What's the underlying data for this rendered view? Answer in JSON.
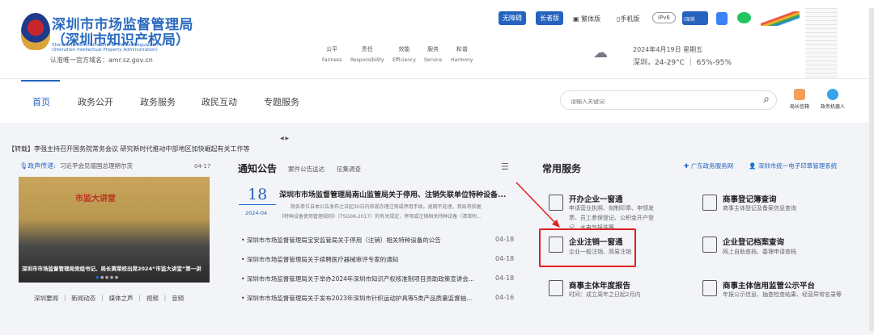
{
  "header": {
    "title_line1": "深圳市市场监督管理局",
    "title_line2": "（深圳市知识产权局）",
    "title_en1": "Shenzhen Administration For Market Regulation",
    "title_en2": "(Shenzhen Intellectual Property Administration)",
    "domain": "认准唯一官方域名：amr.sz.gov.cn",
    "values": [
      {
        "cn": "公平",
        "en": "Fairness"
      },
      {
        "cn": "责任",
        "en": "Responsibility"
      },
      {
        "cn": "效能",
        "en": "Efficiency"
      },
      {
        "cn": "服务",
        "en": "Service"
      },
      {
        "cn": "和谐",
        "en": "Harmony"
      }
    ],
    "toolbar": {
      "accessible": "无障碍",
      "elderly": "长者版",
      "traditional": "繁体版",
      "mobile": "手机版",
      "ipv6": "IPv6",
      "app": "i深圳"
    },
    "weather": {
      "date": "2024年4月19日 星期五",
      "line": "深圳，24-29°C  ｜ 65%-95%"
    },
    "accent": "#2563bf"
  },
  "nav": {
    "items": [
      "首页",
      "政务公开",
      "政务服务",
      "政民互动",
      "专题服务"
    ],
    "active": 0,
    "search_placeholder": "请输入关键词",
    "mailbox": "局长信箱",
    "robot": "政务机器人"
  },
  "headline": "【转载】李强主持召开国务院常务会议 研究新时代推动中部地区加快崛起有关工作等",
  "left": {
    "voice_label": "政声传递:",
    "voice_text": "习近平会见德国总理朔尔茨",
    "voice_date": "04-17",
    "banner_caption": "深圳市市场监督管理局党组书记、局长黄荣校出席2024“市监大讲堂”第一讲",
    "banner_sign": "市监大讲堂",
    "tabs": [
      "深圳要闻",
      "新闻动态",
      "媒体之声",
      "视频",
      "音频"
    ]
  },
  "notice": {
    "title": "通知公告",
    "tabs": [
      "案件公告送达",
      "征集调查"
    ],
    "featured": {
      "day": "18",
      "month": "2024-04",
      "title": "深圳市市场监督管理局南山监管局关于停用、注销失联单位特种设备...",
      "summary1": "限各单位自本公告发布之日起30日内依规办理注销或停用手续。逾期不处理，我局将依据",
      "summary2": "《特种设备使用管理规则》（TSG08-2017）的有关规定，停用或注销相关特种设备（清单附..."
    },
    "items": [
      {
        "text": "深圳市市场监督管理局宝安监管局关于停用（注销）相关特种设备的公告",
        "date": "04-18"
      },
      {
        "text": "深圳市市场监督管理局关于续聘医疗器械审评专家的通知",
        "date": "04-18"
      },
      {
        "text": "深圳市市场监督管理局关于举办2024年深圳市知识产权核准制项目资助政策宣讲会...",
        "date": "04-18"
      },
      {
        "text": "深圳市市场监督管理局关于发布2023年深圳市针织运动护具等5类产品质量监督抽...",
        "date": "04-16"
      }
    ]
  },
  "services": {
    "title": "常用服务",
    "link1": "广东政务服务网",
    "link2": "深圳市统一电子印章管理系统",
    "items": [
      {
        "title": "开办企业一窗通",
        "desc": "申请营业执照、刻制印章、申领发票、员工参保登记、公积金开户登记、水电气报装等"
      },
      {
        "title": "商事登记簿查询",
        "desc": "商事主体登记及备案信息查询"
      },
      {
        "title": "企业注销一窗通",
        "desc": "企业一般注销、简易注销"
      },
      {
        "title": "企业登记档案查询",
        "desc": "网上自助查档、委理申请查档"
      },
      {
        "title": "商事主体年度报告",
        "desc": "时间：成立周年之日起2月内"
      },
      {
        "title": "商事主体信用监管公示平台",
        "desc": "年报公示信息、抽查检查结果、经营异常名录等"
      }
    ],
    "highlight": "#e02020"
  }
}
